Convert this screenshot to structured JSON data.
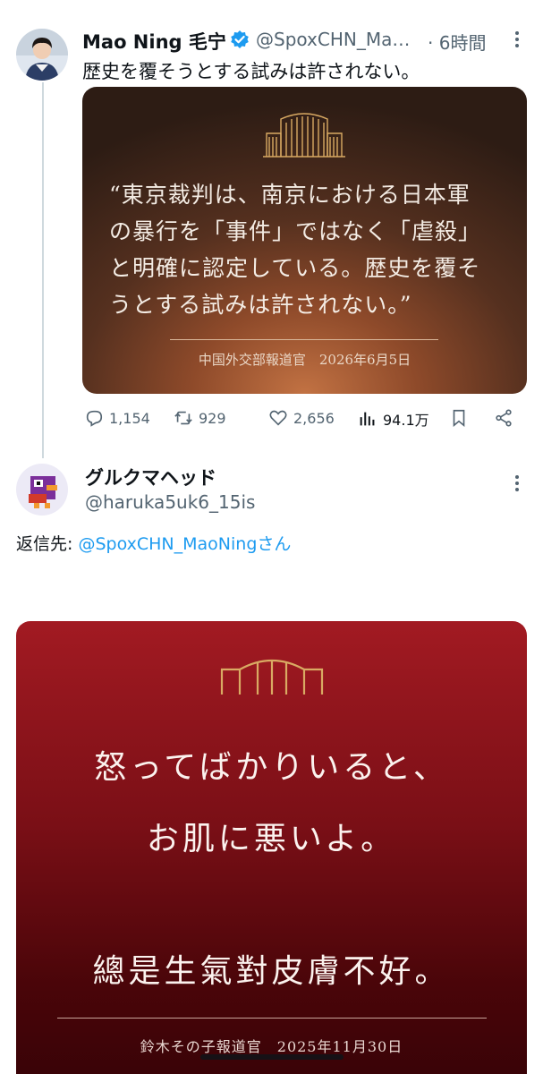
{
  "post1": {
    "author_name": "Mao Ning 毛宁",
    "handle": "@SpoxCHN_Ma…",
    "time": "· 6時間",
    "text": "歴史を覆そうとする試みは許されない。",
    "card": {
      "quote_lines": [
        "“東京裁判は、南京における日本軍",
        "の暴行を「事件」ではなく「虐殺」",
        "と明確に認定している。歴史を覆そ",
        "うとする試みは許されない。”"
      ],
      "source": "中国外交部報道官　2026年6月5日"
    },
    "actions": {
      "replies": "1,154",
      "reposts": "929",
      "likes": "2,656",
      "views": "94.1万"
    }
  },
  "post2": {
    "author_name": "グルクマヘッド",
    "handle": "@haruka5uk6_15is",
    "reply_prefix": "返信先: ",
    "reply_target": "@SpoxCHN_MaoNingさん",
    "card": {
      "line1": "怒ってばかりいると、",
      "line2": "お肌に悪いよ。",
      "line3": "總是生氣對皮膚不好。",
      "source": "鈴木その子報道官　2025年11月30日"
    }
  },
  "icons": {
    "verified": "verified-badge-icon",
    "more": "more-options-icon"
  },
  "colors": {
    "accent": "#1d9bf0",
    "muted": "#536471",
    "card1_glow": "#c27243",
    "card2_red": "#a21a22"
  }
}
